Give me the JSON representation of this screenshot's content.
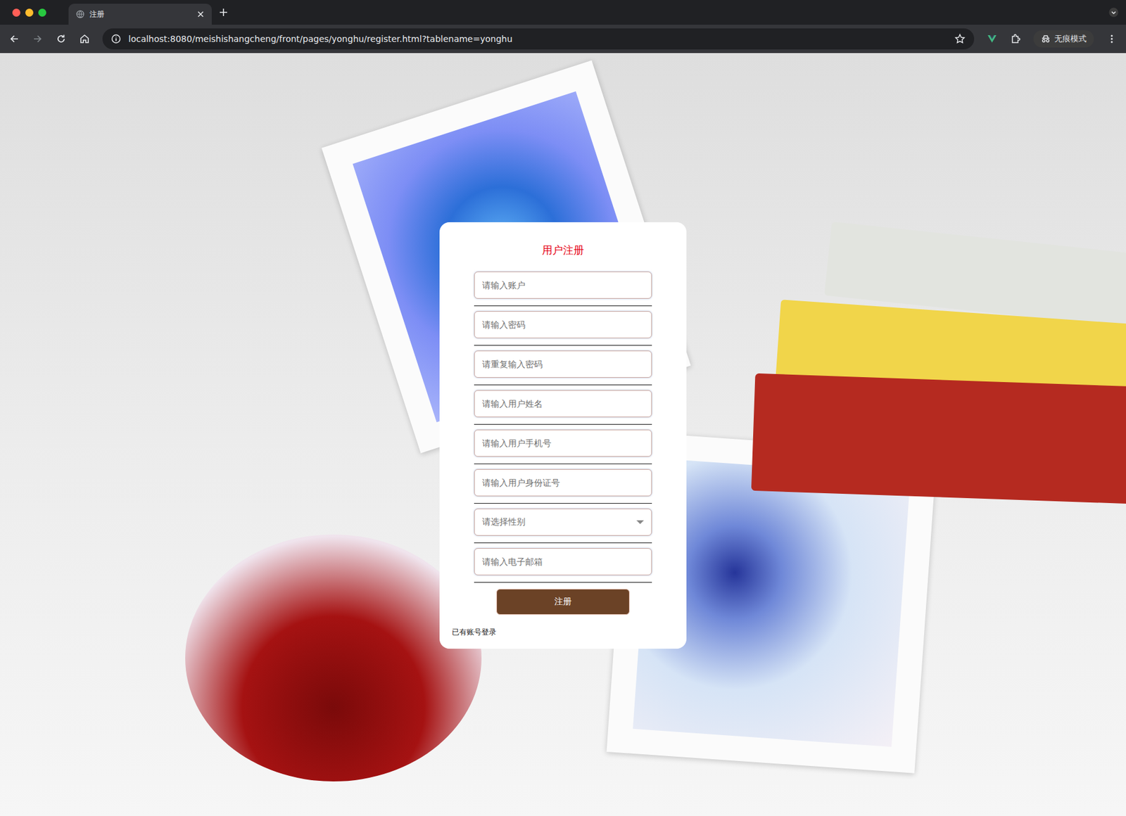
{
  "window": {
    "title": "注册"
  },
  "browser": {
    "url": "localhost:8080/meishishangcheng/front/pages/yonghu/register.html?tablename=yonghu",
    "incognito": "无痕模式"
  },
  "form": {
    "title": "用户注册",
    "fields": [
      {
        "placeholder": "请输入账户",
        "kind": "input"
      },
      {
        "placeholder": "请输入密码",
        "kind": "input"
      },
      {
        "placeholder": "请重复输入密码",
        "kind": "input"
      },
      {
        "placeholder": "请输入用户姓名",
        "kind": "input"
      },
      {
        "placeholder": "请输入用户手机号",
        "kind": "input"
      },
      {
        "placeholder": "请输入用户身份证号",
        "kind": "input"
      },
      {
        "placeholder": "请选择性别",
        "kind": "select"
      },
      {
        "placeholder": "请输入电子邮箱",
        "kind": "input"
      }
    ],
    "button": "注册",
    "login_link": "已有账号登录"
  }
}
